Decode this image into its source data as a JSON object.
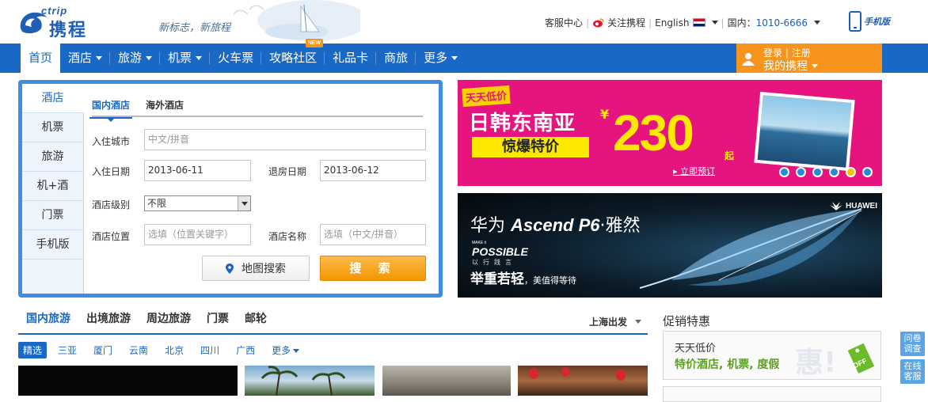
{
  "header": {
    "logo_en": "ctrip",
    "logo_cn": "携程",
    "slogan": "新标志，新旅程",
    "util": {
      "service": "客服中心",
      "follow": "关注携程",
      "language": "English",
      "hotline_label": "国内：",
      "hotline": "1010-6666"
    },
    "mobile_label": "手机版"
  },
  "nav": {
    "items": [
      {
        "label": "首页",
        "dropdown": false
      },
      {
        "label": "酒店",
        "dropdown": true
      },
      {
        "label": "旅游",
        "dropdown": true
      },
      {
        "label": "机票",
        "dropdown": true
      },
      {
        "label": "火车票",
        "dropdown": false
      },
      {
        "label": "攻略社区",
        "dropdown": false,
        "badge": "NEW"
      },
      {
        "label": "礼品卡",
        "dropdown": false
      },
      {
        "label": "商旅",
        "dropdown": false
      },
      {
        "label": "更多",
        "dropdown": true
      }
    ],
    "login": {
      "login": "登录",
      "sep": "|",
      "register": "注册",
      "my_ctrip": "我的携程"
    }
  },
  "search": {
    "side_tabs": [
      "酒店",
      "机票",
      "旅游",
      "机+酒",
      "门票",
      "手机版"
    ],
    "sub_tabs": [
      "国内酒店",
      "海外酒店"
    ],
    "labels": {
      "city": "入住城市",
      "checkin": "入住日期",
      "checkout": "退房日期",
      "star": "酒店级别",
      "location": "酒店位置",
      "name": "酒店名称"
    },
    "values": {
      "city_placeholder": "中文/拼音",
      "checkin": "2013-06-11",
      "checkout": "2013-06-12",
      "star": "不限",
      "location_placeholder": "选填（位置关键字）",
      "name_placeholder": "选填（中文/拼音）"
    },
    "map_button": "地图搜索",
    "search_button": "搜 索"
  },
  "banner1": {
    "tag": "天天低价",
    "title": "日韩东南亚",
    "yen": "¥",
    "subtitle": "惊爆特价",
    "price": "230",
    "price_suffix": "起",
    "link": "▸ 立即预订",
    "active_dot": 4,
    "dot_count": 6
  },
  "banner2": {
    "brand": "HUAWEI",
    "title_cn": "华为",
    "title_model": "Ascend P6",
    "title_tail": "·雅然",
    "make_it": "MAKE it",
    "possible": "POSSIBLE",
    "small_cn": "以行践言",
    "slogan": "举重若轻",
    "slogan_small": "，美值得等待"
  },
  "travel": {
    "tabs": [
      "国内旅游",
      "出境旅游",
      "周边旅游",
      "门票",
      "邮轮"
    ],
    "departure": "上海出发",
    "cities": [
      "精选",
      "三亚",
      "厦门",
      "云南",
      "北京",
      "四川",
      "广西",
      "更多"
    ]
  },
  "promo": {
    "title": "促销特惠",
    "line1": "天天低价",
    "line2": "特价酒店, 机票, 度假",
    "watermark": "惠!",
    "off_label": "OFF"
  },
  "float": {
    "survey": "问卷调查",
    "service": "在线客服"
  },
  "colors": {
    "brand_blue": "#1a68c5",
    "accent_orange": "#f7941d",
    "banner_magenta": "#e5147e"
  }
}
